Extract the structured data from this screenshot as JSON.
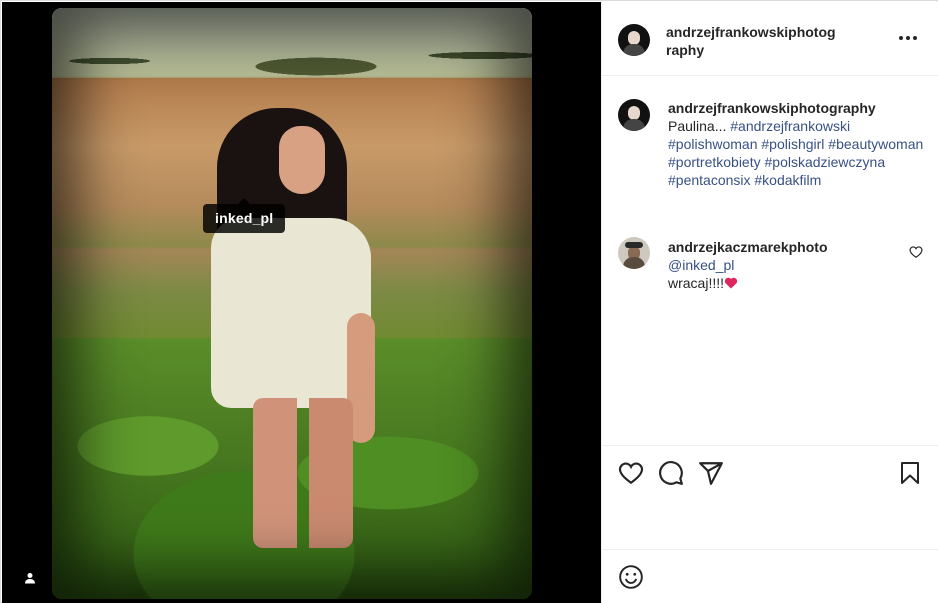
{
  "post": {
    "tag_label": "inked_pl",
    "author": "andrzejfrankowskiphotography"
  },
  "caption": {
    "username": "andrzejfrankowskiphotography",
    "text": "Paulina...",
    "hashtags": "#andrzejfrankowski #polishwoman #polishgirl #beautywoman #portretkobiety #polskadziewczyna #pentaconsix #kodakfilm"
  },
  "comments": [
    {
      "username": "andrzejkaczmarekphoto",
      "mention": "@inked_pl",
      "text": "wracaj!!!!"
    }
  ],
  "icons": {
    "more": "more-horizontal-icon",
    "like": "heart-icon",
    "comment": "comment-icon",
    "share": "share-icon",
    "save": "bookmark-icon",
    "emoji": "emoji-icon",
    "user_tags": "user-icon"
  },
  "colors": {
    "link": "#385185",
    "heart_emoji": "#e0245e"
  }
}
